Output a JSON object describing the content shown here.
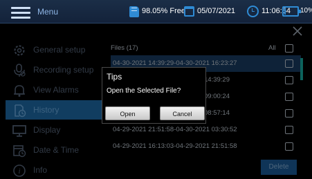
{
  "status_bar": {
    "menu_label": "Menu",
    "storage_free": "98.05% Free",
    "date": "05/07/2021",
    "time": "11:06:54",
    "battery_percent": "10%",
    "battery_level": 0.1,
    "accent_color": "#2f8bd4"
  },
  "sidebar": {
    "items": [
      {
        "label": "General setup",
        "icon": "gear-icon"
      },
      {
        "label": "Recording setup",
        "icon": "recording-setup-icon"
      },
      {
        "label": "View Alarms",
        "icon": "bell-icon"
      },
      {
        "label": "History",
        "icon": "history-icon",
        "active": true
      },
      {
        "label": "Display",
        "icon": "monitor-icon"
      },
      {
        "label": "Date & Time",
        "icon": "calendar-clock-icon"
      },
      {
        "label": "Info",
        "icon": "info-icon"
      }
    ],
    "active_color": "#1f6fb0"
  },
  "files": {
    "title": "Files (17)",
    "all_label": "All",
    "rows": [
      {
        "text": "04-30-2021 14:39:29-04-30-2021 16:23:27",
        "selected": true
      },
      {
        "text": "14:39:29",
        "selected": false
      },
      {
        "text": "09:00:24",
        "selected": false
      },
      {
        "text": "08:57:14",
        "selected": false
      },
      {
        "text": "04-29-2021 21:51:58-04-30-2021 03:30:52",
        "selected": false
      },
      {
        "text": "04-29-2021 16:13:03-04-29-2021 21:51:58",
        "selected": false
      }
    ],
    "delete_label": "Delete"
  },
  "dialog": {
    "title": "Tips",
    "message": "Open the Selected File?",
    "open_label": "Open",
    "cancel_label": "Cancel"
  }
}
